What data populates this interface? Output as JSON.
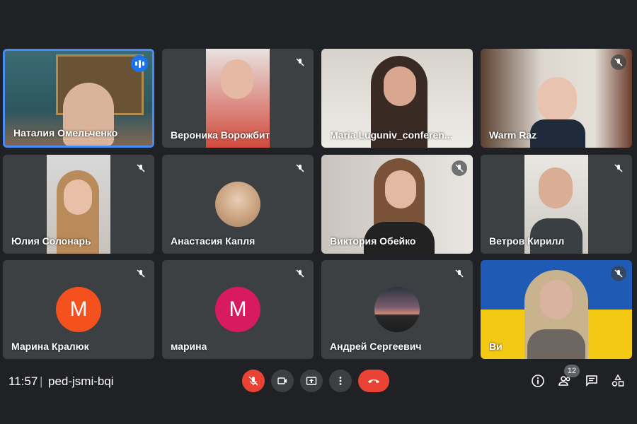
{
  "participants": [
    {
      "name": "Наталия Омельченко",
      "muted": false,
      "speaking": true
    },
    {
      "name": "Вероника Ворожбит",
      "muted": true
    },
    {
      "name": "Maria Luguniv_conferen...",
      "muted": false
    },
    {
      "name": "Warm Raz",
      "muted": true
    },
    {
      "name": "Юлия Солонарь",
      "muted": true
    },
    {
      "name": "Анастасия Капля",
      "muted": true
    },
    {
      "name": "Виктория Обейко",
      "muted": true
    },
    {
      "name": "Ветров Кирилл",
      "muted": true
    },
    {
      "name": "Марина Кралюк",
      "muted": true,
      "initial": "М",
      "avatar_color": "#f4511e"
    },
    {
      "name": "марина",
      "muted": true,
      "initial": "М",
      "avatar_color": "#d81b60"
    },
    {
      "name": "Андрей Сергеевич",
      "muted": true
    },
    {
      "name": "Ви",
      "muted": true
    }
  ],
  "meeting": {
    "time": "11:57",
    "separator": "|",
    "code": "ped-jsmi-bqi"
  },
  "controls": {
    "mic": "mic-off-icon",
    "camera": "camera-icon",
    "present": "present-screen-icon",
    "more": "more-options-icon",
    "end": "end-call-icon"
  },
  "right_controls": {
    "participants_count": "12"
  },
  "colors": {
    "background": "#202124",
    "tile": "#3c4043",
    "accent": "#1a73e8",
    "danger": "#ea4335"
  }
}
